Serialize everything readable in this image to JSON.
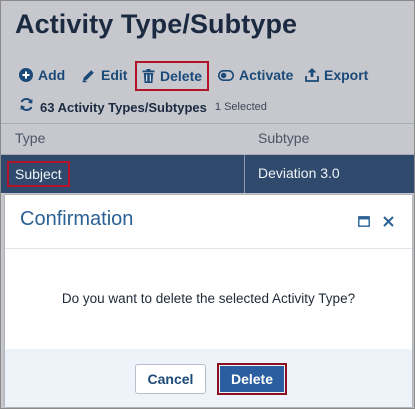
{
  "page": {
    "title": "Activity Type/Subtype"
  },
  "toolbar": {
    "add": "Add",
    "edit": "Edit",
    "delete": "Delete",
    "activate": "Activate",
    "export": "Export"
  },
  "summary": {
    "count_text": "63 Activity Types/Subtypes",
    "selected_text": "1 Selected"
  },
  "grid": {
    "columns": [
      "Type",
      "Subtype"
    ],
    "rows": [
      {
        "type": "Subject",
        "subtype": "Deviation 3.0"
      }
    ]
  },
  "dialog": {
    "title": "Confirmation",
    "message": "Do you want to delete the selected Activity Type?",
    "cancel_label": "Cancel",
    "delete_label": "Delete"
  },
  "colors": {
    "accent": "#2b6194",
    "selected_row": "#2f4a6d",
    "highlight_border": "#b3112a",
    "primary_button": "#2a5ea0"
  }
}
